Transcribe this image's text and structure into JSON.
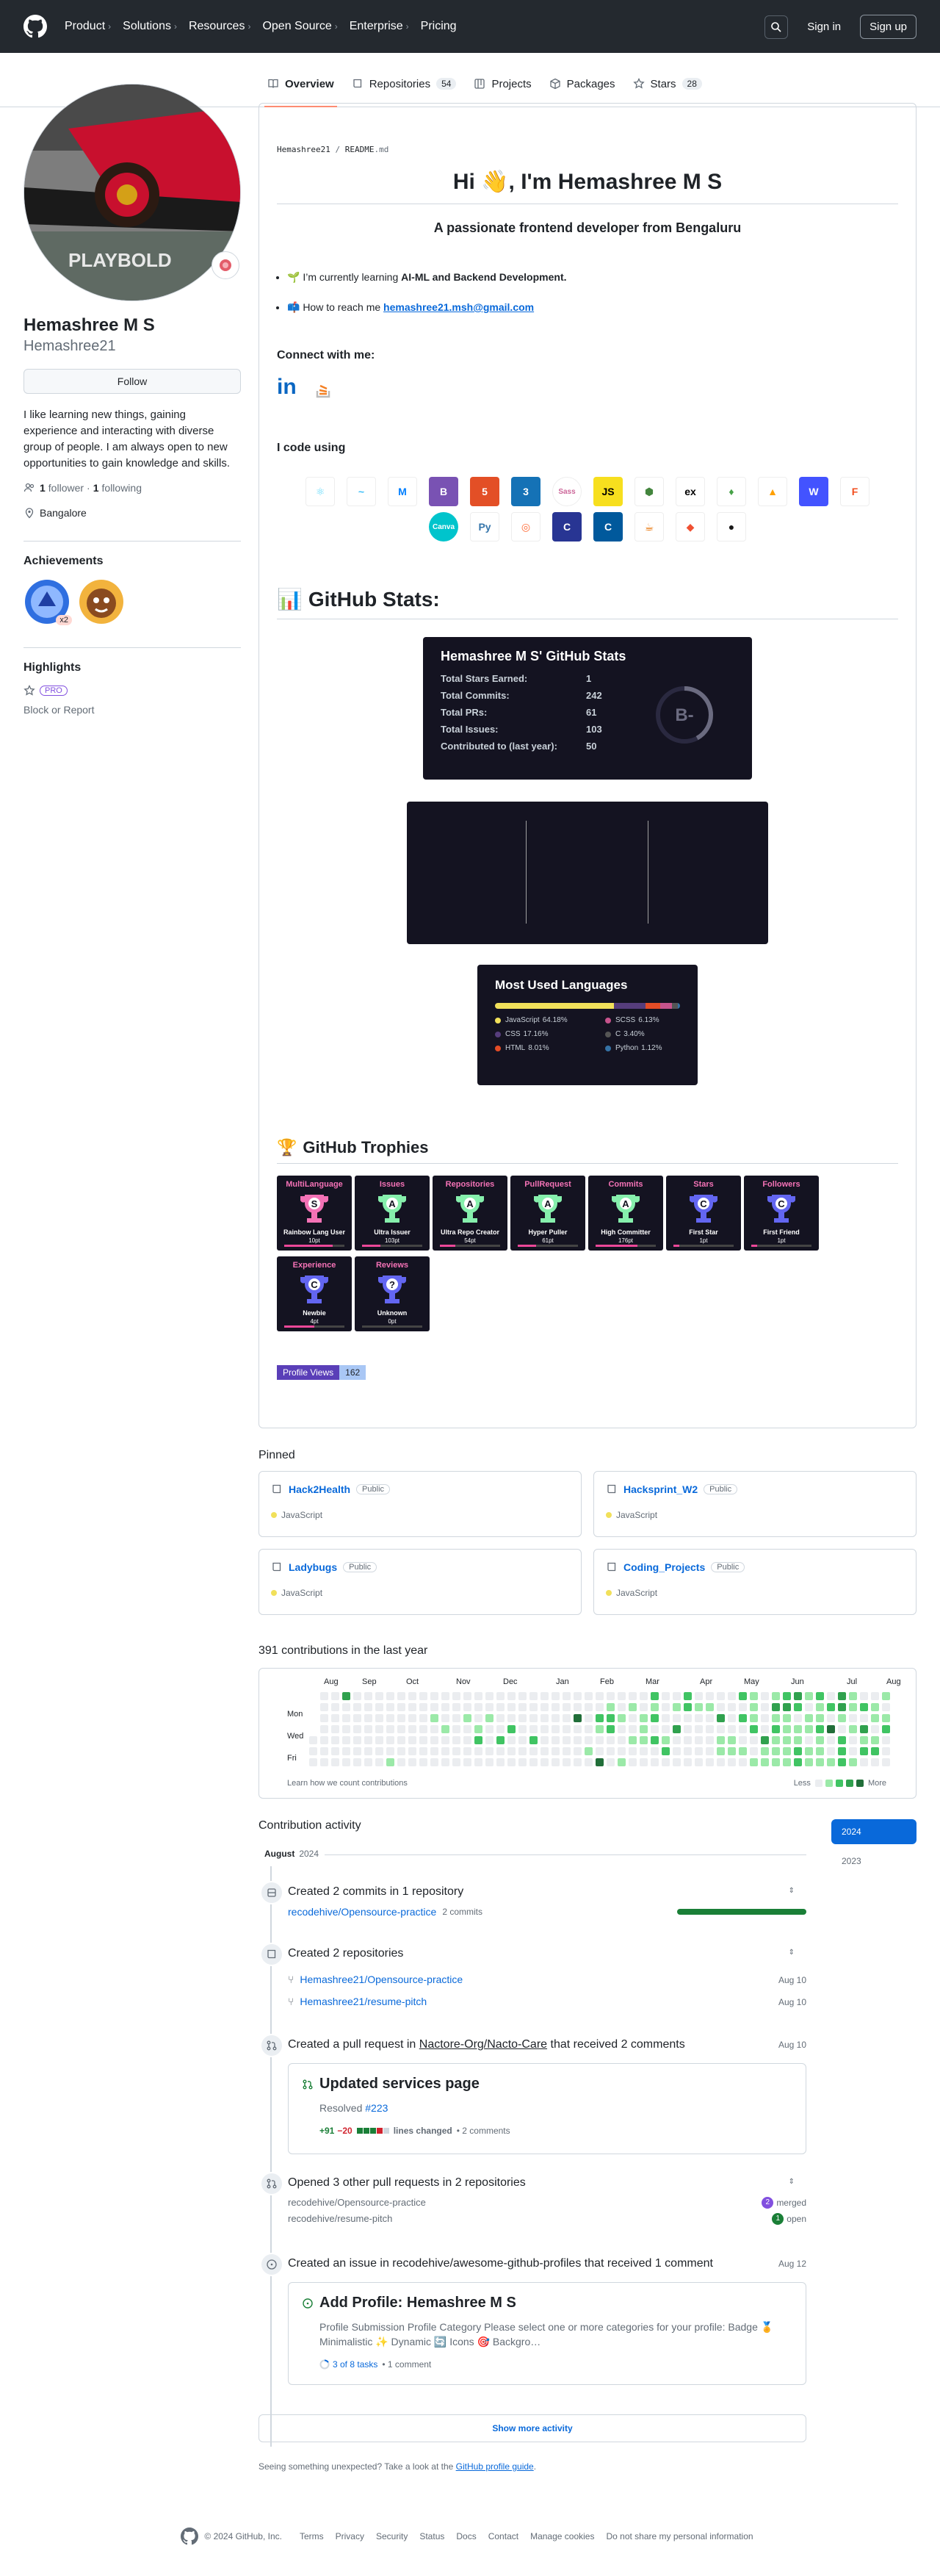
{
  "header": {
    "nav": [
      {
        "label": "Product",
        "dropdown": true
      },
      {
        "label": "Solutions",
        "dropdown": true
      },
      {
        "label": "Resources",
        "dropdown": true
      },
      {
        "label": "Open Source",
        "dropdown": true
      },
      {
        "label": "Enterprise",
        "dropdown": true
      },
      {
        "label": "Pricing",
        "dropdown": false
      }
    ],
    "signin": "Sign in",
    "signup": "Sign up"
  },
  "tabs": [
    {
      "label": "Overview",
      "count": null,
      "icon": "book-icon"
    },
    {
      "label": "Repositories",
      "count": "54",
      "icon": "repo-icon"
    },
    {
      "label": "Projects",
      "count": null,
      "icon": "project-icon"
    },
    {
      "label": "Packages",
      "count": null,
      "icon": "package-icon"
    },
    {
      "label": "Stars",
      "count": "28",
      "icon": "star-icon"
    }
  ],
  "profile": {
    "name": "Hemashree M S",
    "login": "Hemashree21",
    "follow": "Follow",
    "bio": "I like learning new things, gaining experience and interacting with diverse group of people. I am always open to new opportunities to gain knowledge and skills.",
    "followers": "1",
    "followers_label": "follower",
    "following": "1",
    "following_label": "following",
    "location": "Bangalore",
    "achievements_title": "Achievements",
    "achievement_count": "x2",
    "highlights_title": "Highlights",
    "pro": "PRO",
    "block": "Block or Report",
    "avatar_text": "PLAYBOLD"
  },
  "readme": {
    "path_user": "Hemashree21",
    "path_sep": " / ",
    "path_file": "README",
    "path_ext": ".md",
    "title": "Hi 👋, I'm Hemashree M S",
    "subtitle": "A passionate frontend developer from Bengaluru",
    "learning_prefix": "🌱 I’m currently learning ",
    "learning_bold": "AI-ML and Backend Development.",
    "reach_prefix": "📫 How to reach me ",
    "reach_email": "hemashree21.msh@gmail.com",
    "connect": "Connect with me:",
    "code_using": "I code using",
    "stats_heading": "GitHub Stats:",
    "stats_emoji": "📊",
    "trophies_heading": "GitHub Trophies",
    "trophies_emoji": "🏆",
    "views_label": "Profile Views",
    "views_value": "162"
  },
  "skills": [
    {
      "name": "react-icon",
      "color": "#61dafb",
      "text": "⚛",
      "fg": "#61dafb",
      "bg": "#ffffff"
    },
    {
      "name": "tailwind-icon",
      "color": "#38bdf8",
      "text": "~",
      "fg": "#38bdf8",
      "bg": "#ffffff"
    },
    {
      "name": "mui-icon",
      "color": "#007fff",
      "text": "M",
      "fg": "#007fff",
      "bg": "#ffffff"
    },
    {
      "name": "bootstrap-icon",
      "color": "#7952b3",
      "text": "B",
      "fg": "#ffffff",
      "bg": "#7952b3"
    },
    {
      "name": "html5-icon",
      "color": "#e34f26",
      "text": "5",
      "fg": "#ffffff",
      "bg": "#e34f26"
    },
    {
      "name": "css3-icon",
      "color": "#1572b6",
      "text": "3",
      "fg": "#ffffff",
      "bg": "#1572b6"
    },
    {
      "name": "sass-icon",
      "color": "#cc6699",
      "text": "Sass",
      "fg": "#cc6699",
      "bg": "#ffffff"
    },
    {
      "name": "javascript-icon",
      "color": "#f7df1e",
      "text": "JS",
      "fg": "#000000",
      "bg": "#f7df1e"
    },
    {
      "name": "nodejs-icon",
      "color": "#43853d",
      "text": "⬢",
      "fg": "#43853d",
      "bg": "#ffffff"
    },
    {
      "name": "express-icon",
      "color": "#000000",
      "text": "ex",
      "fg": "#000000",
      "bg": "#ffffff"
    },
    {
      "name": "mongodb-icon",
      "color": "#47a248",
      "text": "♦",
      "fg": "#47a248",
      "bg": "#ffffff"
    },
    {
      "name": "firebase-icon",
      "color": "#ffca28",
      "text": "▲",
      "fg": "#ffa000",
      "bg": "#ffffff"
    },
    {
      "name": "webflow-icon",
      "color": "#4353ff",
      "text": "W",
      "fg": "#ffffff",
      "bg": "#4353ff"
    },
    {
      "name": "figma-icon",
      "color": "#f24e1e",
      "text": "F",
      "fg": "#f24e1e",
      "bg": "#ffffff"
    },
    {
      "name": "canva-icon",
      "color": "#00c4cc",
      "text": "Canva",
      "fg": "#ffffff",
      "bg": "#00c4cc"
    },
    {
      "name": "python-icon",
      "color": "#3776ab",
      "text": "Py",
      "fg": "#3776ab",
      "bg": "#ffffff"
    },
    {
      "name": "postman-icon",
      "color": "#ff6c37",
      "text": "◎",
      "fg": "#ff6c37",
      "bg": "#ffffff"
    },
    {
      "name": "c-icon",
      "color": "#283593",
      "text": "C",
      "fg": "#ffffff",
      "bg": "#283593"
    },
    {
      "name": "cplusplus-icon",
      "color": "#00599c",
      "text": "C",
      "fg": "#ffffff",
      "bg": "#00599c"
    },
    {
      "name": "java-icon",
      "color": "#007396",
      "text": "☕",
      "fg": "#e76f00",
      "bg": "#ffffff"
    },
    {
      "name": "git-icon",
      "color": "#f05032",
      "text": "◆",
      "fg": "#f05032",
      "bg": "#ffffff"
    },
    {
      "name": "github-icon",
      "color": "#181717",
      "text": "●",
      "fg": "#181717",
      "bg": "#ffffff"
    }
  ],
  "stats_card": {
    "title": "Hemashree M S' GitHub Stats",
    "rows": [
      {
        "label": "Total Stars Earned:",
        "value": "1"
      },
      {
        "label": "Total Commits:",
        "value": "242"
      },
      {
        "label": "Total PRs:",
        "value": "61"
      },
      {
        "label": "Total Issues:",
        "value": "103"
      },
      {
        "label": "Contributed to (last year):",
        "value": "50"
      }
    ],
    "grade": "B-",
    "grade_fraction": 0.42
  },
  "languages": {
    "title": "Most Used Languages",
    "items": [
      {
        "name": "JavaScript",
        "pct": "64.18%",
        "value": 64.18,
        "color": "#f1e05a"
      },
      {
        "name": "SCSS",
        "pct": "6.13%",
        "value": 6.13,
        "color": "#c6538c"
      },
      {
        "name": "CSS",
        "pct": "17.16%",
        "value": 17.16,
        "color": "#563d7c"
      },
      {
        "name": "C",
        "pct": "3.40%",
        "value": 3.4,
        "color": "#555555"
      },
      {
        "name": "HTML",
        "pct": "8.01%",
        "value": 8.01,
        "color": "#e34c26"
      },
      {
        "name": "Python",
        "pct": "1.12%",
        "value": 1.12,
        "color": "#3572a5"
      }
    ]
  },
  "trophies": [
    {
      "title": "MultiLanguage",
      "rank": "S",
      "name": "Rainbow Lang User",
      "points": "10pt",
      "color": "#f472b6",
      "cup": "#f472b6",
      "progress": 0.8
    },
    {
      "title": "Issues",
      "rank": "A",
      "name": "Ultra Issuer",
      "points": "103pt",
      "color": "#f472b6",
      "cup": "#86efac",
      "progress": 0.3
    },
    {
      "title": "Repositories",
      "rank": "A",
      "name": "Ultra Repo Creator",
      "points": "54pt",
      "color": "#f472b6",
      "cup": "#86efac",
      "progress": 0.25
    },
    {
      "title": "PullRequest",
      "rank": "A",
      "name": "Hyper Puller",
      "points": "61pt",
      "color": "#f472b6",
      "cup": "#86efac",
      "progress": 0.3
    },
    {
      "title": "Commits",
      "rank": "A",
      "name": "High Committer",
      "points": "176pt",
      "color": "#f472b6",
      "cup": "#86efac",
      "progress": 0.7
    },
    {
      "title": "Stars",
      "rank": "C",
      "name": "First Star",
      "points": "1pt",
      "color": "#f472b6",
      "cup": "#6366f1",
      "progress": 0.1
    },
    {
      "title": "Followers",
      "rank": "C",
      "name": "First Friend",
      "points": "1pt",
      "color": "#f472b6",
      "cup": "#6366f1",
      "progress": 0.1
    },
    {
      "title": "Experience",
      "rank": "C",
      "name": "Newbie",
      "points": "4pt",
      "color": "#f472b6",
      "cup": "#6366f1",
      "progress": 0.5
    },
    {
      "title": "Reviews",
      "rank": "?",
      "name": "Unknown",
      "points": "0pt",
      "color": "#f472b6",
      "cup": "#6366f1",
      "progress": 0
    }
  ],
  "pinned": {
    "title": "Pinned",
    "items": [
      {
        "name": "Hack2Health",
        "visibility": "Public",
        "language": "JavaScript",
        "lang_color": "#f1e05a"
      },
      {
        "name": "Hacksprint_W2",
        "visibility": "Public",
        "language": "JavaScript",
        "lang_color": "#f1e05a"
      },
      {
        "name": "Ladybugs",
        "visibility": "Public",
        "language": "JavaScript",
        "lang_color": "#f1e05a"
      },
      {
        "name": "Coding_Projects",
        "visibility": "Public",
        "language": "JavaScript",
        "lang_color": "#f1e05a"
      }
    ]
  },
  "contributions": {
    "title": "391 contributions in the last year",
    "months": [
      "Aug",
      "Sep",
      "Oct",
      "Nov",
      "Dec",
      "Jan",
      "Feb",
      "Mar",
      "Apr",
      "May",
      "Jun",
      "Jul",
      "Aug"
    ],
    "days": [
      "Mon",
      "Wed",
      "Fri"
    ],
    "learn": "Learn how we count contributions",
    "less": "Less",
    "more": "More"
  },
  "activity": {
    "title": "Contribution activity",
    "years": [
      "2024",
      "2023"
    ],
    "month_label": "August",
    "month_year": "2024",
    "ev1_title": "Created 2 commits in 1 repository",
    "ev1_repo": "recodehive/Opensource-practice",
    "ev1_commits": "2 commits",
    "ev2_title": "Created 2 repositories",
    "ev2_repos": [
      {
        "name": "Hemashree21/Opensource-practice",
        "date": "Aug 10"
      },
      {
        "name": "Hemashree21/resume-pitch",
        "date": "Aug 10"
      }
    ],
    "ev3_prefix": "Created a pull request in ",
    "ev3_repo": "Nactore-Org/Nacto-Care",
    "ev3_suffix": " that received 2 comments",
    "ev3_date": "Aug 10",
    "pr_title": "Updated services page",
    "pr_resolved_prefix": "Resolved ",
    "pr_resolved_issue": "#223",
    "pr_add": "+91",
    "pr_del": "−20",
    "pr_lines": "lines changed",
    "pr_comments": "• 2 comments",
    "ev4_title": "Opened 3 other pull requests in 2 repositories",
    "ev4_rows": [
      {
        "repo": "recodehive/Opensource-practice",
        "count": "2",
        "state": "merged",
        "color": "#8250df"
      },
      {
        "repo": "recodehive/resume-pitch",
        "count": "1",
        "state": "open",
        "color": "#1a7f37"
      }
    ],
    "ev5_title": "Created an issue in recodehive/awesome-github-profiles that received 1 comment",
    "ev5_date": "Aug 12",
    "issue_title": "Add Profile: Hemashree M S",
    "issue_body": "Profile Submission Profile Category Please select one or more categories for your profile: Badge 🏅 Minimalistic ✨ Dynamic 🔄 Icons 🎯 Backgro…",
    "issue_tasks": "3 of 8 tasks",
    "issue_comments": "• 1 comment",
    "show_more": "Show more activity",
    "unexpected_prefix": "Seeing something unexpected? Take a look at the ",
    "unexpected_link": "GitHub profile guide",
    "unexpected_suffix": "."
  },
  "footer": {
    "copyright": "© 2024 GitHub, Inc.",
    "links": [
      "Terms",
      "Privacy",
      "Security",
      "Status",
      "Docs",
      "Contact",
      "Manage cookies",
      "Do not share my personal information"
    ]
  }
}
